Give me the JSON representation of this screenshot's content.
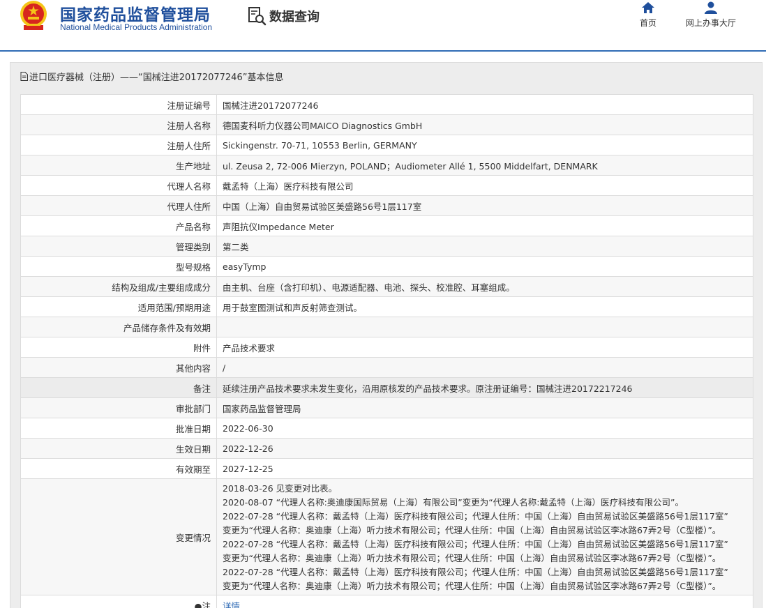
{
  "header": {
    "org_name_cn": "国家药品监督管理局",
    "org_name_en": "National Medical Products Administration",
    "query_label": "数据查询",
    "nav": [
      {
        "label": "首页",
        "icon": "home-icon"
      },
      {
        "label": "网上办事大厅",
        "icon": "user-icon"
      }
    ]
  },
  "panel": {
    "title": "进口医疗器械（注册）——“国械注进20172077246”基本信息"
  },
  "fields": [
    {
      "label": "注册证编号",
      "value": "国械注进20172077246"
    },
    {
      "label": "注册人名称",
      "value": "德国麦科听力仪器公司MAICO Diagnostics GmbH"
    },
    {
      "label": "注册人住所",
      "value": "Sickingenstr. 70-71, 10553 Berlin, GERMANY"
    },
    {
      "label": "生产地址",
      "value": "ul. Zeusa 2, 72-006 Mierzyn, POLAND；Audiometer Allé 1, 5500 Middelfart, DENMARK"
    },
    {
      "label": "代理人名称",
      "value": "戴孟特（上海）医疗科技有限公司"
    },
    {
      "label": "代理人住所",
      "value": "中国（上海）自由贸易试验区美盛路56号1层117室"
    },
    {
      "label": "产品名称",
      "value": "声阻抗仪Impedance Meter"
    },
    {
      "label": "管理类别",
      "value": "第二类"
    },
    {
      "label": "型号规格",
      "value": "easyTymp"
    },
    {
      "label": "结构及组成/主要组成成分",
      "value": "由主机、台座（含打印机）、电源适配器、电池、探头、校准腔、耳塞组成。"
    },
    {
      "label": "适用范围/预期用途",
      "value": "用于鼓室图测试和声反射筛查测试。"
    },
    {
      "label": "产品储存条件及有效期",
      "value": ""
    },
    {
      "label": "附件",
      "value": "产品技术要求"
    },
    {
      "label": "其他内容",
      "value": "/"
    },
    {
      "label": "备注",
      "value": "延续注册产品技术要求未发生变化，沿用原核发的产品技术要求。原注册证编号：国械注进20172217246"
    },
    {
      "label": "审批部门",
      "value": "国家药品监督管理局"
    },
    {
      "label": "批准日期",
      "value": "2022-06-30"
    },
    {
      "label": "生效日期",
      "value": "2022-12-26"
    },
    {
      "label": "有效期至",
      "value": "2027-12-25"
    }
  ],
  "changes": {
    "label": "变更情况",
    "lines": [
      "2018-03-26 见变更对比表。",
      "2020-08-07 “代理人名称:奥迪康国际贸易（上海）有限公司”变更为“代理人名称:戴孟特（上海）医疗科技有限公司”。",
      "2022-07-28 “代理人名称：戴孟特（上海）医疗科技有限公司；代理人住所：中国（上海）自由贸易试验区美盛路56号1层117室”",
      "变更为“代理人名称：奥迪康（上海）听力技术有限公司；代理人住所：中国（上海）自由贸易试验区李冰路67弄2号（C型楼）”。",
      "2022-07-28 “代理人名称：戴孟特（上海）医疗科技有限公司；代理人住所：中国（上海）自由贸易试验区美盛路56号1层117室”",
      "变更为“代理人名称：奥迪康（上海）听力技术有限公司；代理人住所：中国（上海）自由贸易试验区李冰路67弄2号（C型楼）”。",
      "2022-07-28 “代理人名称：戴孟特（上海）医疗科技有限公司；代理人住所：中国（上海）自由贸易试验区美盛路56号1层117室”",
      "变更为“代理人名称：奥迪康（上海）听力技术有限公司；代理人住所：中国（上海）自由贸易试验区李冰路67弄2号（C型楼）”。"
    ]
  },
  "note_row": {
    "label": "●注",
    "value": "详情"
  },
  "colors": {
    "brand_blue": "#1f4f9c",
    "accent_blue": "#2f6bb5",
    "emblem_red": "#d7261e",
    "emblem_gold": "#f5c518"
  }
}
